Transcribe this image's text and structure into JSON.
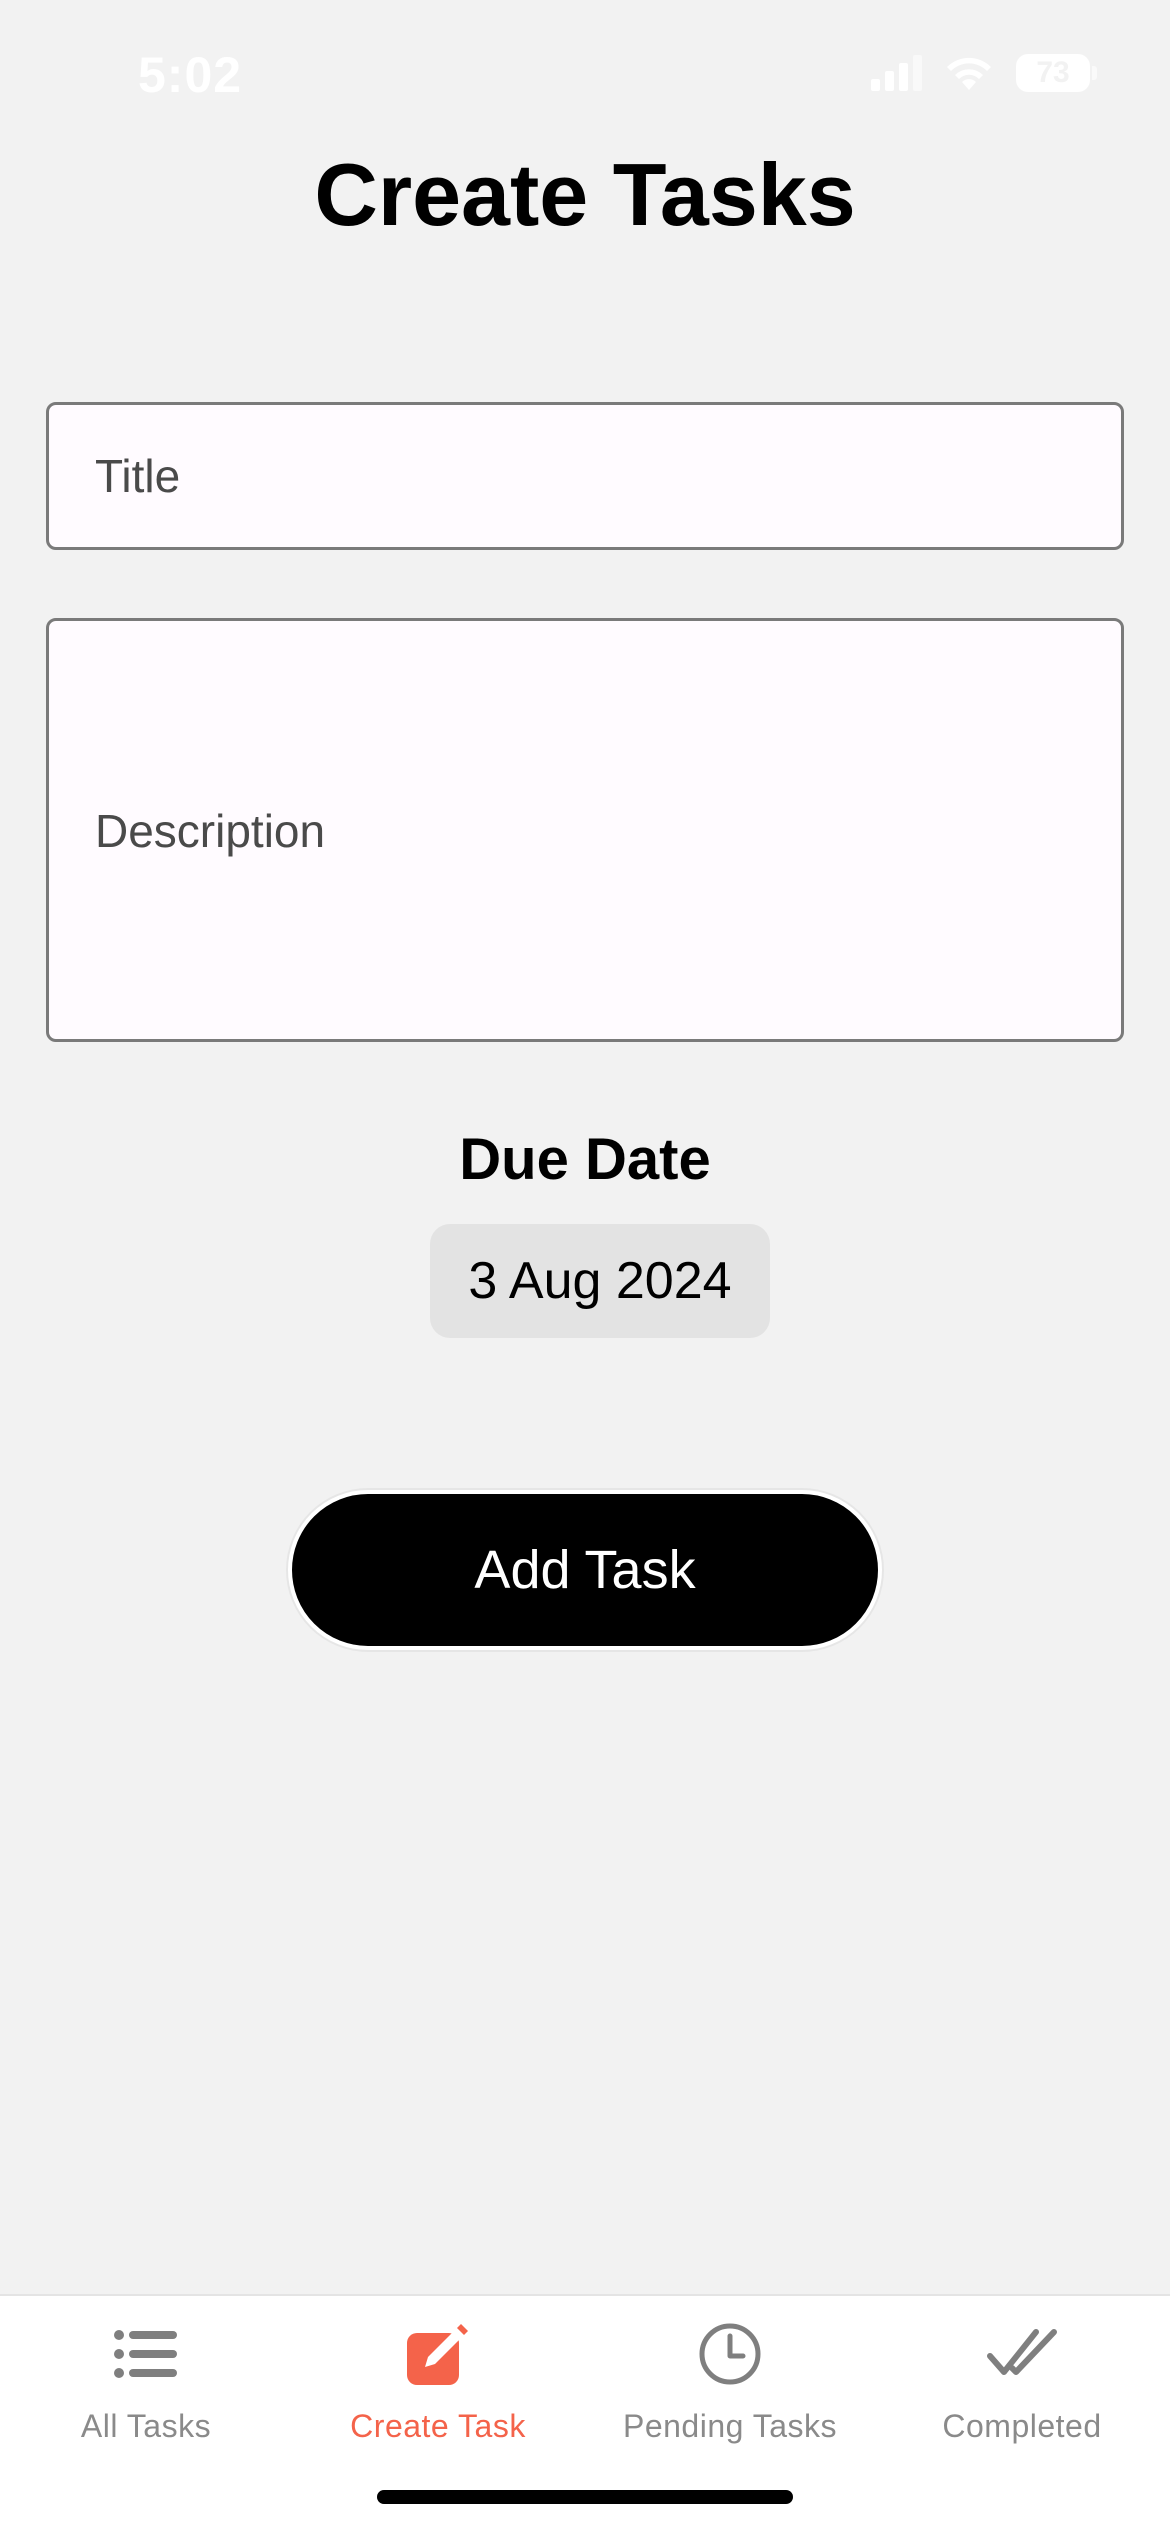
{
  "status_bar": {
    "time": "5:02",
    "battery": "73"
  },
  "page": {
    "title": "Create Tasks"
  },
  "form": {
    "title_placeholder": "Title",
    "title_value": "",
    "description_placeholder": "Description",
    "description_value": "",
    "due_date_label": "Due Date",
    "due_date_value": "3 Aug 2024",
    "submit_label": "Add Task"
  },
  "tab_bar": {
    "items": [
      {
        "label": "All Tasks",
        "icon": "list-icon",
        "active": false
      },
      {
        "label": "Create Task",
        "icon": "edit-icon",
        "active": true
      },
      {
        "label": "Pending Tasks",
        "icon": "clock-icon",
        "active": false
      },
      {
        "label": "Completed",
        "icon": "double-check-icon",
        "active": false
      }
    ],
    "active_color": "#f4634a",
    "inactive_color": "#8a8a8a"
  }
}
